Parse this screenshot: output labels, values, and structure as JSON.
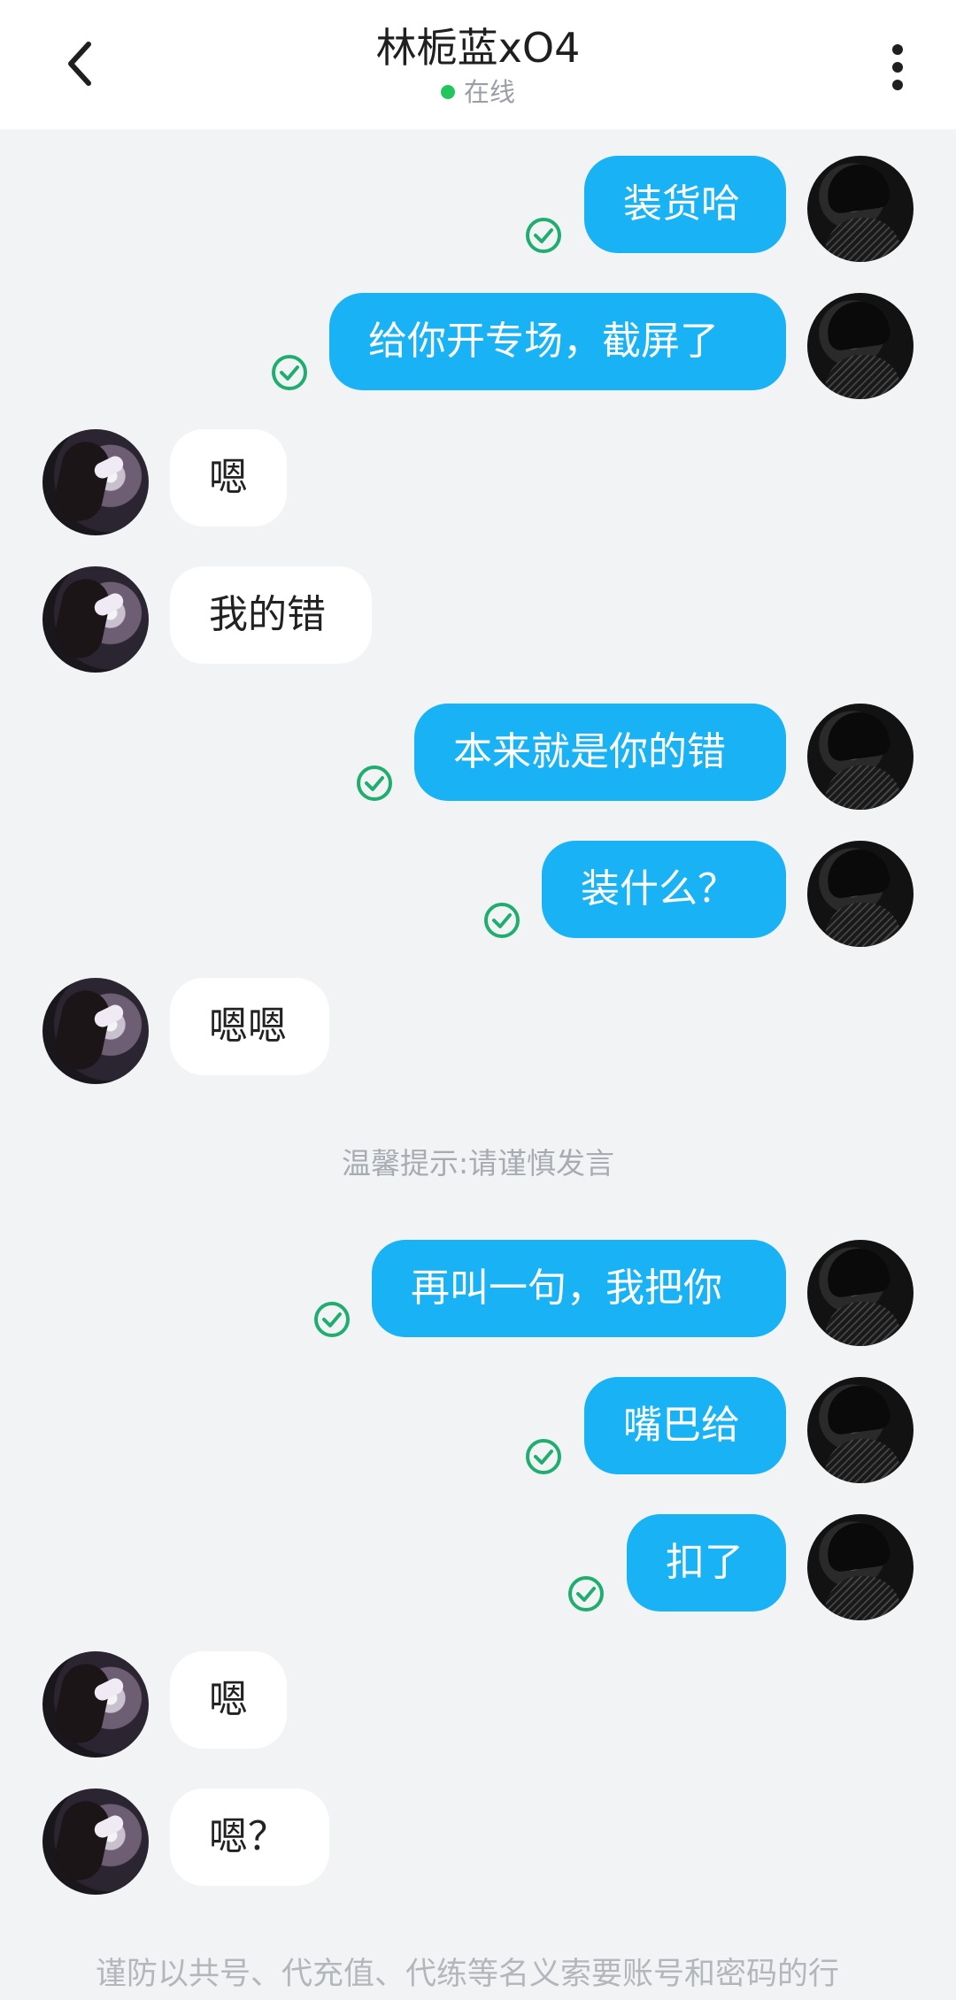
{
  "header": {
    "contact_name": "林栀蓝xO4",
    "status": "在线"
  },
  "messages": [
    {
      "from": "me",
      "text": "装货哈",
      "read": true
    },
    {
      "from": "me",
      "text": "给你开专场，截屏了",
      "read": true
    },
    {
      "from": "other",
      "text": "嗯"
    },
    {
      "from": "other",
      "text": "我的错"
    },
    {
      "from": "me",
      "text": "本来就是你的错",
      "read": true
    },
    {
      "from": "me",
      "text": "装什么？",
      "read": true
    },
    {
      "from": "other",
      "text": "嗯嗯"
    },
    {
      "from": "me",
      "text": "再叫一句，我把你",
      "read": true
    },
    {
      "from": "me",
      "text": "嘴巴给",
      "read": true
    },
    {
      "from": "me",
      "text": "扣了",
      "read": true
    },
    {
      "from": "other",
      "text": "嗯"
    },
    {
      "from": "other",
      "text": "嗯？"
    }
  ],
  "system_tip": "温馨提示:请谨慎发言",
  "warning": "谨防以共号、代充值、代练等名义索要账号和密码的行",
  "icons": {
    "back": "chevron-left-icon",
    "more": "more-vertical-icon",
    "read": "check-circle-icon"
  },
  "colors": {
    "my_bubble": "#19b3f5",
    "other_bubble": "#ffffff",
    "background": "#f2f3f5",
    "online": "#22c55e",
    "read_check": "#1fae6f"
  }
}
